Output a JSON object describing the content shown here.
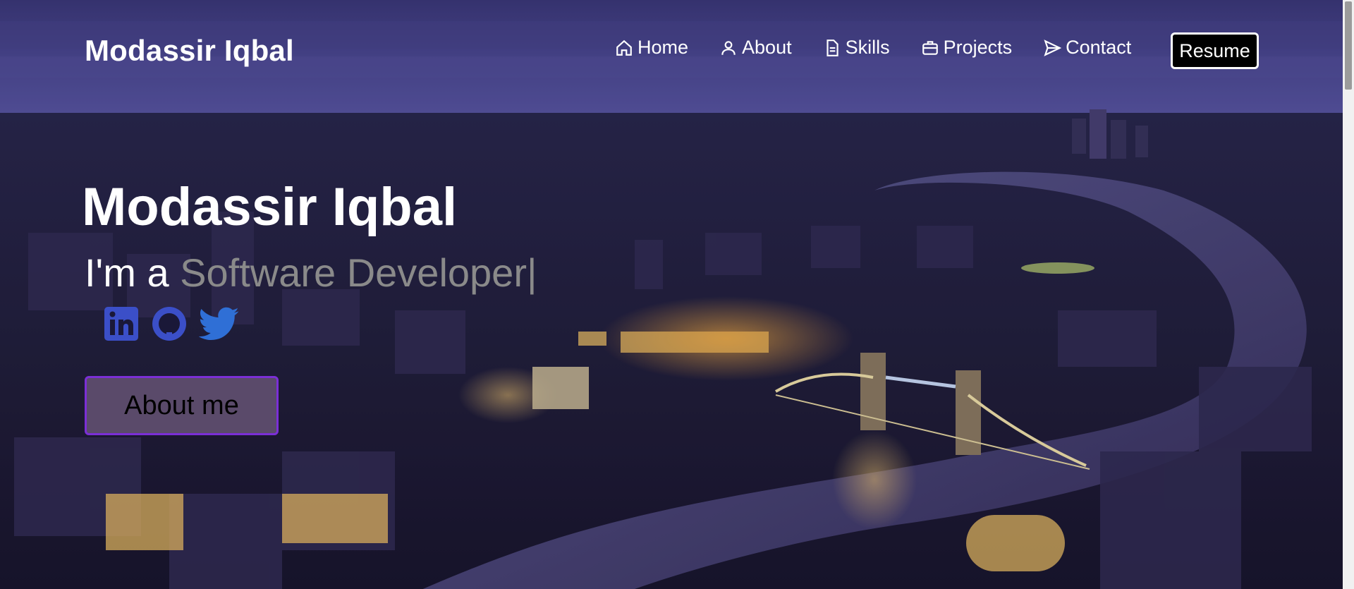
{
  "header": {
    "brand": "Modassir Iqbal",
    "nav": [
      {
        "label": "Home",
        "icon": "home-icon"
      },
      {
        "label": "About",
        "icon": "user-icon"
      },
      {
        "label": "Skills",
        "icon": "document-icon"
      },
      {
        "label": "Projects",
        "icon": "briefcase-icon"
      },
      {
        "label": "Contact",
        "icon": "send-icon"
      }
    ],
    "resume_label": "Resume"
  },
  "hero": {
    "title": "Modassir Iqbal",
    "typing_prefix": "I'm a ",
    "typing_role": "Software Developer",
    "cursor": "|",
    "socials": [
      "linkedin-icon",
      "github-icon",
      "twitter-icon"
    ],
    "about_button": "About me"
  },
  "colors": {
    "social_blue": "#3b4fc8",
    "twitter_blue": "#2f6fd6",
    "about_bg": "#5a4a6a",
    "about_border": "#7b2fd6",
    "muted_text": "#8a8a8a"
  }
}
